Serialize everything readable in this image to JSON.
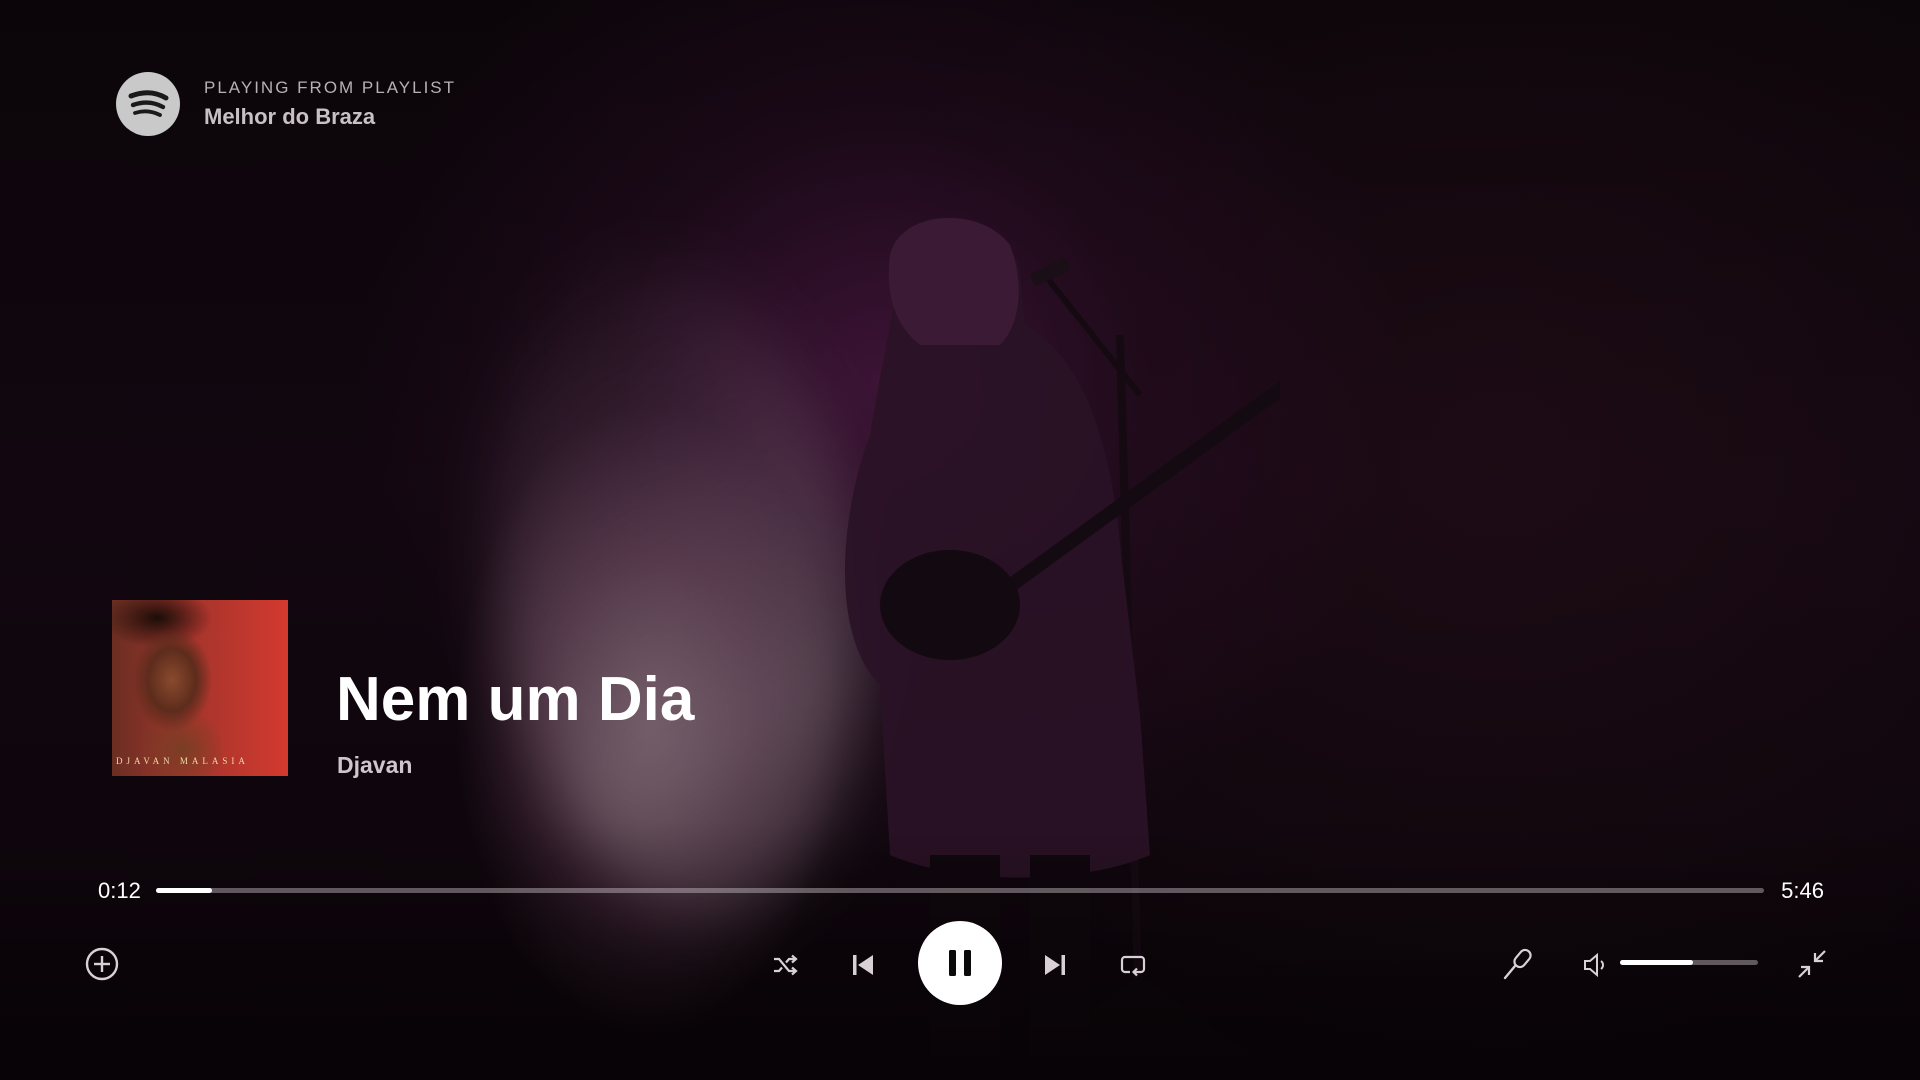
{
  "context": {
    "label": "PLAYING FROM PLAYLIST",
    "name": "Melhor do Braza"
  },
  "track": {
    "title": "Nem um Dia",
    "artist": "Djavan",
    "cover_text": "DJAVAN MALASIA"
  },
  "playback": {
    "elapsed": "0:12",
    "total": "5:46",
    "progress_fraction": 0.035,
    "state": "playing"
  },
  "volume": {
    "level_fraction": 0.53
  },
  "icons": {
    "logo": "spotify-logo-icon",
    "add": "add-circle-icon",
    "shuffle": "shuffle-icon",
    "previous": "skip-previous-icon",
    "pause": "pause-icon",
    "next": "skip-next-icon",
    "repeat": "repeat-icon",
    "lyrics": "microphone-icon",
    "volume": "volume-icon",
    "exit_fullscreen": "minimize-icon"
  },
  "colors": {
    "accent": "#ffffff",
    "background": "#0a0408",
    "cover_red": "#d4392f"
  }
}
